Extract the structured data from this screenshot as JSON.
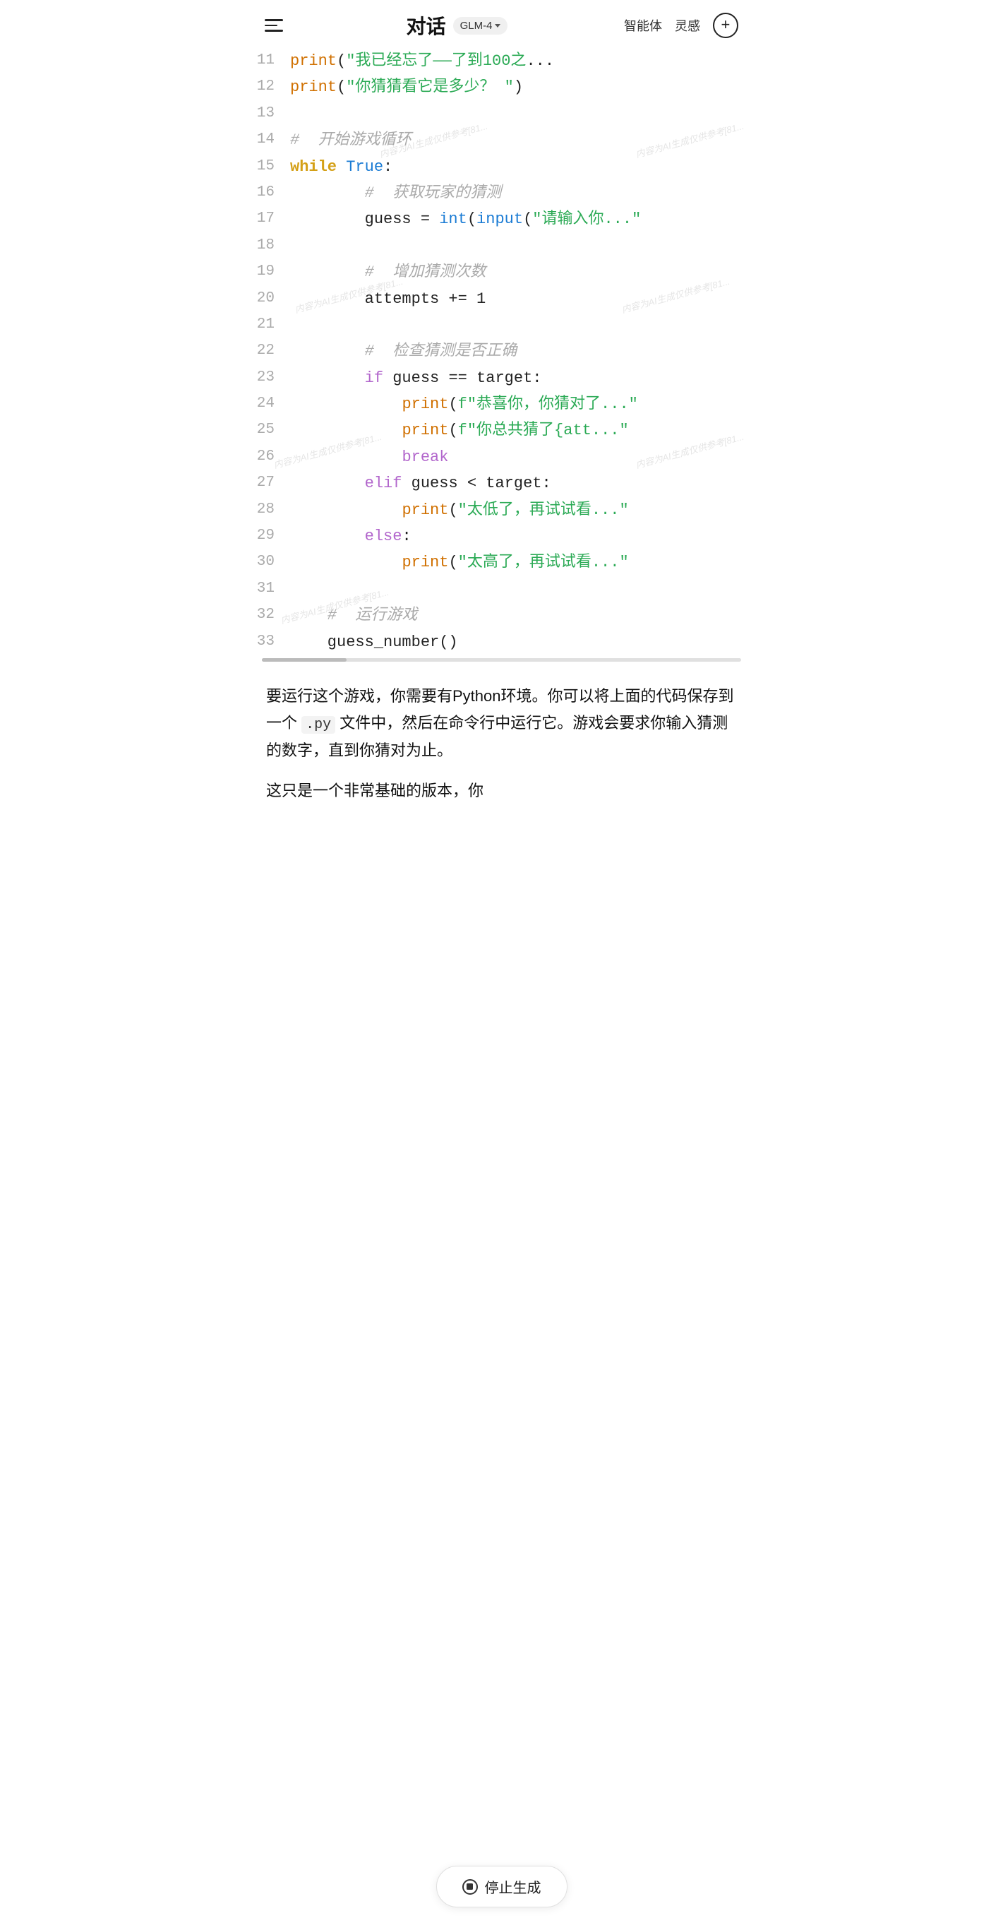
{
  "header": {
    "title": "对话",
    "model": "GLM-4",
    "nav_agent": "智能体",
    "nav_inspire": "灵感"
  },
  "code": {
    "lines": [
      {
        "num": "11",
        "tokens": [
          {
            "t": "fn-print",
            "v": "print"
          },
          {
            "t": "var-default",
            "v": "("
          },
          {
            "t": "str-green",
            "v": "\"我已经忘了——了到100之"
          },
          {
            "t": "var-default",
            "v": "..."
          }
        ]
      },
      {
        "num": "12",
        "tokens": [
          {
            "t": "fn-print",
            "v": "print"
          },
          {
            "t": "var-default",
            "v": "("
          },
          {
            "t": "str-green",
            "v": "\"你猜猜看它是多少？ \""
          },
          {
            "t": "var-default",
            "v": ")"
          }
        ]
      },
      {
        "num": "13",
        "tokens": []
      },
      {
        "num": "14",
        "tokens": [
          {
            "t": "comment",
            "v": "#  开始游戏循环"
          }
        ]
      },
      {
        "num": "15",
        "tokens": [
          {
            "t": "kw-while",
            "v": "while"
          },
          {
            "t": "var-default",
            "v": " "
          },
          {
            "t": "kw-true",
            "v": "True"
          },
          {
            "t": "var-default",
            "v": ":"
          }
        ]
      },
      {
        "num": "16",
        "tokens": [
          {
            "t": "comment",
            "v": "        #  获取玩家的猜测"
          }
        ]
      },
      {
        "num": "17",
        "tokens": [
          {
            "t": "var-default",
            "v": "        guess = "
          },
          {
            "t": "fn-int",
            "v": "int"
          },
          {
            "t": "var-default",
            "v": "("
          },
          {
            "t": "fn-input",
            "v": "input"
          },
          {
            "t": "var-default",
            "v": "("
          },
          {
            "t": "str-green",
            "v": "\"请输入你...\""
          }
        ]
      },
      {
        "num": "18",
        "tokens": []
      },
      {
        "num": "19",
        "tokens": [
          {
            "t": "comment",
            "v": "        #  增加猜测次数"
          }
        ]
      },
      {
        "num": "20",
        "tokens": [
          {
            "t": "var-default",
            "v": "        attempts += 1"
          }
        ]
      },
      {
        "num": "21",
        "tokens": []
      },
      {
        "num": "22",
        "tokens": [
          {
            "t": "comment",
            "v": "        #  检查猜测是否正确"
          }
        ]
      },
      {
        "num": "23",
        "tokens": [
          {
            "t": "var-default",
            "v": "        "
          },
          {
            "t": "kw-if",
            "v": "if"
          },
          {
            "t": "var-default",
            "v": " guess == target:"
          }
        ]
      },
      {
        "num": "24",
        "tokens": [
          {
            "t": "var-default",
            "v": "            "
          },
          {
            "t": "fn-print",
            "v": "print"
          },
          {
            "t": "var-default",
            "v": "("
          },
          {
            "t": "str-fstr",
            "v": "f\"恭喜你，你猜对了...\""
          }
        ]
      },
      {
        "num": "25",
        "tokens": [
          {
            "t": "var-default",
            "v": "            "
          },
          {
            "t": "fn-print",
            "v": "print"
          },
          {
            "t": "var-default",
            "v": "("
          },
          {
            "t": "str-fstr",
            "v": "f\"你总共猜了{att...\""
          }
        ]
      },
      {
        "num": "26",
        "tokens": [
          {
            "t": "var-default",
            "v": "            "
          },
          {
            "t": "kw-break",
            "v": "break"
          }
        ]
      },
      {
        "num": "27",
        "tokens": [
          {
            "t": "var-default",
            "v": "        "
          },
          {
            "t": "kw-elif",
            "v": "elif"
          },
          {
            "t": "var-default",
            "v": " guess < target:"
          }
        ]
      },
      {
        "num": "28",
        "tokens": [
          {
            "t": "var-default",
            "v": "            "
          },
          {
            "t": "fn-print",
            "v": "print"
          },
          {
            "t": "var-default",
            "v": "("
          },
          {
            "t": "str-green",
            "v": "\"太低了，再试试看...\""
          }
        ]
      },
      {
        "num": "29",
        "tokens": [
          {
            "t": "var-default",
            "v": "        "
          },
          {
            "t": "kw-else",
            "v": "else"
          },
          {
            "t": "var-default",
            "v": ":"
          }
        ]
      },
      {
        "num": "30",
        "tokens": [
          {
            "t": "var-default",
            "v": "            "
          },
          {
            "t": "fn-print",
            "v": "print"
          },
          {
            "t": "var-default",
            "v": "("
          },
          {
            "t": "str-green",
            "v": "\"太高了，再试试看...\""
          }
        ]
      },
      {
        "num": "31",
        "tokens": []
      },
      {
        "num": "32",
        "tokens": [
          {
            "t": "comment",
            "v": "    #  运行游戏"
          }
        ]
      },
      {
        "num": "33",
        "tokens": [
          {
            "t": "var-default",
            "v": "    guess_number()"
          }
        ]
      }
    ]
  },
  "message": {
    "para1": "要运行这个游戏，你需要有Python环境。你可以将上面的代码保存到一个 .py 文件中，然后在命令行中运行它。游戏会要求你输入猜测的数字，直到你猜对为止。",
    "py_ext": ".py",
    "para2": "这只是一个非常基础的版本，你"
  },
  "stop_button": {
    "label": "停止生成"
  },
  "watermark_text": "内容为AI生成仅供参考[81..."
}
